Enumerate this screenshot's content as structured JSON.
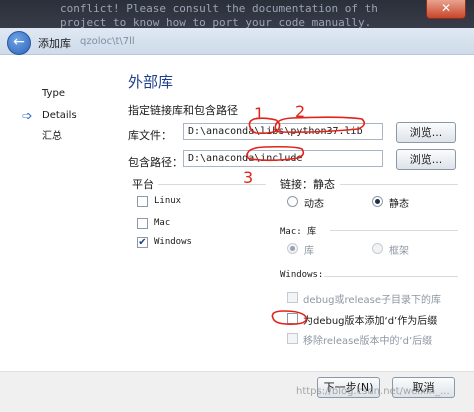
{
  "window": {
    "title": "添加库",
    "subtitle": "qzoloc\\t\\7ll",
    "background_code": "conflict! Please consult the documentation of th\nproject to know how to port your code manually."
  },
  "sidebar": {
    "items": [
      {
        "label": "Type"
      },
      {
        "label": "Details"
      },
      {
        "label": "汇总"
      }
    ]
  },
  "main": {
    "heading": "外部库",
    "subtitle": "指定链接库和包含路径",
    "library_file_label": "库文件：",
    "library_file_value": "D:\\anaconda\\libs\\python37.lib",
    "include_path_label": "包含路径：",
    "include_path_value": "D:\\anaconda\\include",
    "browse_label": "浏览...",
    "platform": {
      "label": "平台",
      "options": [
        {
          "label": "Linux",
          "checked": false
        },
        {
          "label": "Mac",
          "checked": false
        },
        {
          "label": "Windows",
          "checked": true
        }
      ]
    },
    "linkage": {
      "label": "链接：静态",
      "options": [
        {
          "label": "动态",
          "selected": false
        },
        {
          "label": "静态",
          "selected": true
        }
      ]
    },
    "mac": {
      "label": "Mac: 库",
      "options": [
        {
          "label": "库",
          "selected": true
        },
        {
          "label": "框架",
          "selected": false
        }
      ]
    },
    "windows": {
      "label": "Windows:",
      "options": [
        {
          "label": "debug或release子目录下的库",
          "checked": false,
          "enabled": false
        },
        {
          "label": "为debug版本添加‘d’作为后缀",
          "checked": false,
          "enabled": true
        },
        {
          "label": "移除release版本中的‘d’后缀",
          "checked": false,
          "enabled": false
        }
      ]
    }
  },
  "footer": {
    "next_label": "下一步(N)",
    "cancel_label": "取消",
    "watermark": "https://blog.csdn.net/weixin_..."
  },
  "annotations": {
    "marker_1": "1",
    "marker_2": "2",
    "marker_3": "3",
    "color": "#e2231a"
  }
}
